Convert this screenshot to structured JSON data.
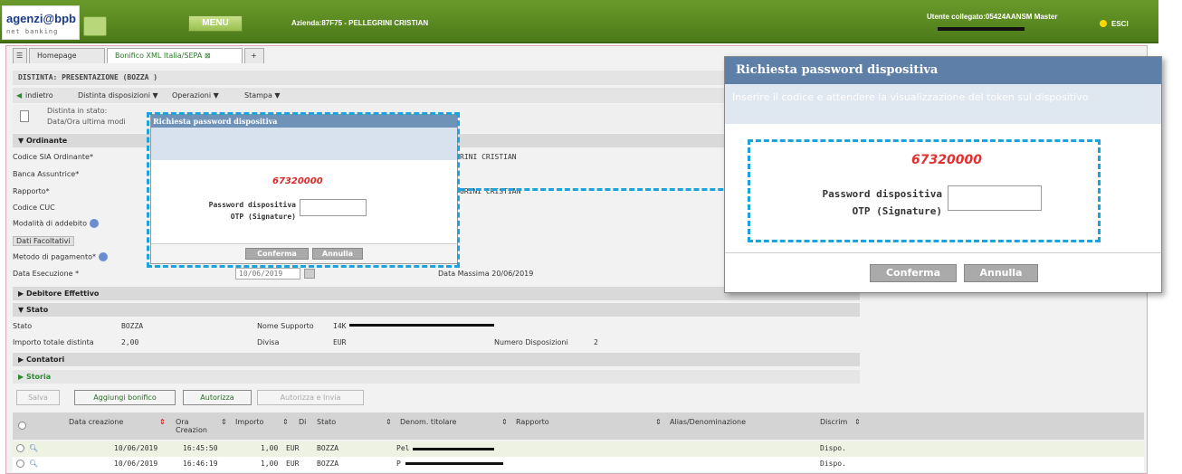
{
  "header": {
    "logo_text": "agenzi@bpb",
    "logo_sub": "net banking",
    "menu_label": "MENU",
    "azienda": "Azienda:87F75 - PELLEGRINI CRISTIAN",
    "utente": "Utente collegato:05424AANSM Master",
    "esci": "ESCI"
  },
  "tabs": [
    "Homepage",
    "Bonifico XML Italia/SEPA ⊠",
    "+"
  ],
  "page": {
    "title": "DISTINTA: PRESENTAZIONE (BOZZA )",
    "toolbar": {
      "back": "indietro",
      "menu1": "Distinta disposizioni ▼",
      "menu2": "Operazioni ▼",
      "menu3": "Stampa ▼"
    },
    "stato_line1": "Distinta in stato:",
    "stato_line2": "Data/Ora ultima modi"
  },
  "ordinante": {
    "section": "Ordinante",
    "labels": [
      "Codice SIA Ordinante*",
      "Banca Assuntrice*",
      "Rapporto*",
      "Codice CUC",
      "Modalità di addebito",
      "Dati Facoltativi",
      "Metodo di pagamento*",
      "Data Esecuzione *"
    ],
    "value1": "RINI CRISTIAN",
    "value2": "GRINI CRISTIAN",
    "data_esecuzione": "10/06/2019",
    "data_massima": "Data Massima 20/06/2019"
  },
  "sections": {
    "debitore": "Debitore Effettivo",
    "stato": "Stato",
    "contatori": "Contatori",
    "storia": "Storia"
  },
  "stato": {
    "stato_label": "Stato",
    "stato_value": "BOZZA",
    "supporto_label": "Nome Supporto",
    "supporto_value": "I4K",
    "importo_label": "Importo totale distinta",
    "importo_value": "2,00",
    "divisa_label": "Divisa",
    "divisa_value": "EUR",
    "numero_label": "Numero Disposizioni",
    "numero_value": "2"
  },
  "actions": {
    "salva": "Salva",
    "aggiungi": "Aggiungi bonifico",
    "autorizza": "Autorizza",
    "autorizza_invia": "Autorizza e Invia"
  },
  "grid": {
    "headers": [
      "Data creazione",
      "Ora Creazion",
      "Importo",
      "Di",
      "Stato",
      "Denom. titolare",
      "Rapporto",
      "Alias/Denominazione",
      "Discrim"
    ],
    "rows": [
      {
        "data": "10/06/2019",
        "ora": "16:45:50",
        "importo": "1,00",
        "div": "EUR",
        "stato": "BOZZA",
        "denom": "Pel",
        "discrim": "Dispo."
      },
      {
        "data": "10/06/2019",
        "ora": "16:46:19",
        "importo": "1,00",
        "div": "EUR",
        "stato": "BOZZA",
        "denom": "P",
        "discrim": "Dispo."
      }
    ]
  },
  "modal_small": {
    "title": "Richiesta password dispositiva",
    "code": "67320000",
    "label_line1": "Password dispositiva",
    "label_line2": "OTP (Signature)",
    "confirm": "Conferma",
    "cancel": "Annulla"
  },
  "modal_big": {
    "title": "Richiesta password dispositiva",
    "subtitle": "Inserire il codice e attendere la visualizzazione del token sul dispositivo",
    "code": "67320000",
    "label_line1": "Password dispositiva",
    "label_line2": "OTP (Signature)",
    "confirm": "Conferma",
    "cancel": "Annulla"
  },
  "colors": {
    "topbar": "#5a8a22",
    "accent": "#1aa3dc",
    "code": "#d42a2a",
    "modal_head": "#5d7fa8"
  }
}
